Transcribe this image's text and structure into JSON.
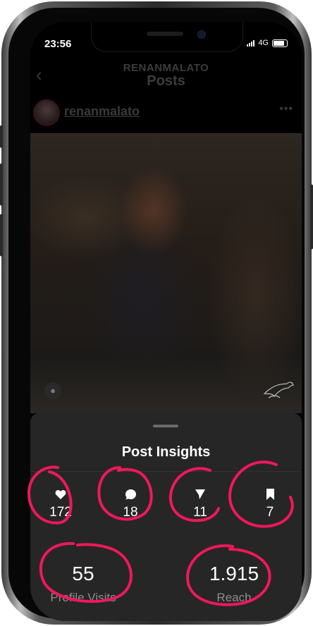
{
  "status_bar": {
    "time": "23:56",
    "network": "4G"
  },
  "header": {
    "username": "RENANMALATO",
    "title": "Posts"
  },
  "post": {
    "username": "renanmalato"
  },
  "insights": {
    "title": "Post Insights",
    "likes": "172",
    "comments": "18",
    "shares": "11",
    "saves": "7",
    "profile_visits_value": "55",
    "profile_visits_label": "Profile Visits",
    "reach_value": "1.915",
    "reach_label": "Reach"
  },
  "colors": {
    "annotation": "#f0185a",
    "sheet_bg": "#262626",
    "muted_text": "#8e8e8e"
  },
  "icons": [
    "back-chevron-icon",
    "more-icon",
    "person-tag-icon",
    "heart-icon",
    "comment-icon",
    "share-icon",
    "bookmark-icon"
  ]
}
